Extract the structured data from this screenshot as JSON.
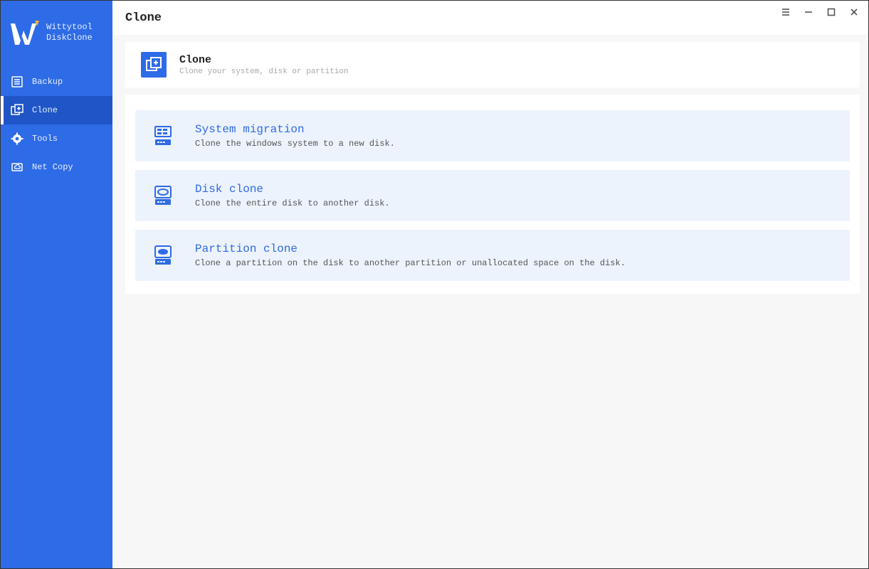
{
  "app": {
    "name_line1": "Wittytool",
    "name_line2": "DiskClone"
  },
  "page": {
    "title": "Clone"
  },
  "nav": {
    "items": [
      {
        "label": "Backup"
      },
      {
        "label": "Clone"
      },
      {
        "label": "Tools"
      },
      {
        "label": "Net Copy"
      }
    ],
    "active_index": 1
  },
  "section": {
    "title": "Clone",
    "desc": "Clone your system, disk or partition"
  },
  "options": [
    {
      "title": "System migration",
      "desc": "Clone the windows system to a new disk."
    },
    {
      "title": "Disk clone",
      "desc": "Clone the entire disk to another disk."
    },
    {
      "title": "Partition clone",
      "desc": "Clone a partition on the disk to another partition or unallocated space on the disk."
    }
  ],
  "colors": {
    "accent": "#2e6be6",
    "accent_dark": "#1f55c7",
    "option_bg": "#edf3fc"
  }
}
